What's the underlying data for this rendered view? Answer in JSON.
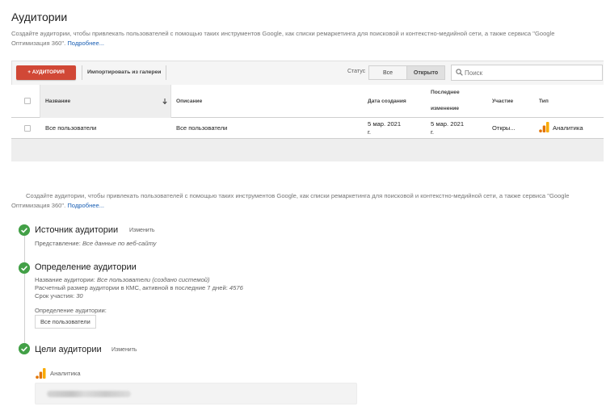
{
  "page": {
    "title": "Аудитории",
    "intro": "Создайте аудитории, чтобы привлекать пользователей с помощью таких инструментов Google, как списки ремаркетинга для поисковой и контекстно-медийной сети, а также сервиса \"Google Оптимизация 360\".",
    "more_link": "Подробнее..."
  },
  "toolbar": {
    "add_label": "+ АУДИТОРИЯ",
    "import_label": "Импортировать из галереи",
    "status_label": "Статус",
    "status_options": [
      "Все",
      "Открыто"
    ],
    "status_selected": "Открыто",
    "search_placeholder": "Поиск"
  },
  "table": {
    "headers": {
      "name": "Название",
      "description": "Описание",
      "created": "Дата создания",
      "modified_line1": "Последнее",
      "modified_line2": "изменение",
      "participation": "Участие",
      "type": "Тип"
    },
    "rows": [
      {
        "name": "Все пользователи",
        "description": "Все пользователи",
        "created_line1": "5 мар. 2021",
        "created_line2": "г.",
        "modified_line1": "5 мар. 2021",
        "modified_line2": "г.",
        "participation": "Откры...",
        "type": "Аналитика"
      }
    ]
  },
  "detail": {
    "intro": "Создайте аудитории, чтобы привлекать пользователей с помощью таких инструментов Google, как списки ремаркетинга для поисковой и контекстно-медийной сети, а также сервиса \"Google Оптимизация 360\".",
    "more_link": "Подробнее...",
    "steps": [
      {
        "title": "Источник аудитории",
        "edit": "Изменить",
        "lines": [
          {
            "label": "Представление: ",
            "value": "Все данные по веб-сайту"
          }
        ]
      },
      {
        "title": "Определение аудитории",
        "lines": [
          {
            "label": "Название аудитории: ",
            "value": "Все пользователи (создано системой)"
          },
          {
            "label": "Расчетный размер аудитории в КМС, активной в последние 7 дней: ",
            "value": "4576"
          },
          {
            "label": "Срок участия: ",
            "value": "30"
          }
        ],
        "definition_label": "Определение аудитории:",
        "definition_chip": "Все пользователи"
      },
      {
        "title": "Цели аудитории",
        "edit": "Изменить",
        "destination": "Аналитика"
      }
    ]
  },
  "colors": {
    "accent_button": "#d14836",
    "link": "#1a5fb4",
    "check": "#43a047",
    "analytics_dark": "#e37400",
    "analytics_light": "#f9ab00"
  },
  "icons": {
    "search": "search-icon",
    "sort": "sort-down-icon",
    "analytics": "analytics-icon",
    "step_done": "check-circle-icon"
  }
}
